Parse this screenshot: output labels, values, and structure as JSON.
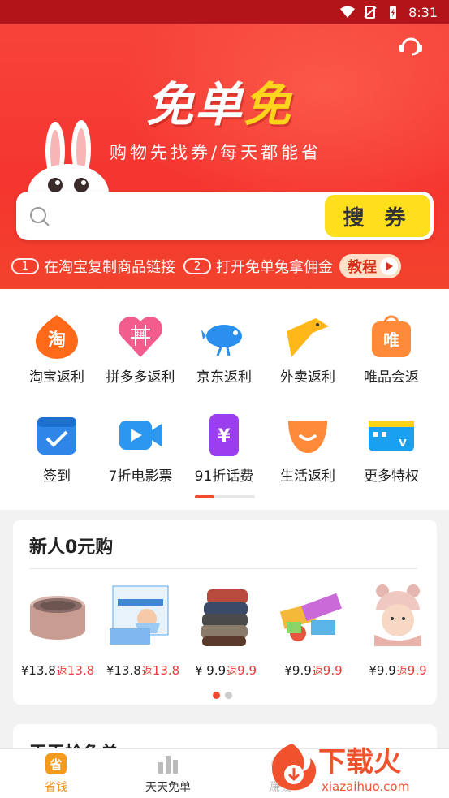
{
  "status_bar": {
    "time": "8:31"
  },
  "hero": {
    "logo_part1": "免单",
    "logo_part2": "免",
    "slogan": "购物先找券/每天都能省",
    "search": {
      "placeholder": "",
      "button_label": "搜 券"
    },
    "steps": [
      {
        "num": "1",
        "text": "在淘宝复制商品链接"
      },
      {
        "num": "2",
        "text": "打开免单兔拿佣金"
      }
    ],
    "tutorial_label": "教程"
  },
  "grid": {
    "items": [
      {
        "label": "淘宝返利",
        "icon": "taobao-icon"
      },
      {
        "label": "拼多多返利",
        "icon": "pinduoduo-icon"
      },
      {
        "label": "京东返利",
        "icon": "jd-icon"
      },
      {
        "label": "外卖返利",
        "icon": "takeout-icon"
      },
      {
        "label": "唯品会返",
        "icon": "vipshop-icon"
      },
      {
        "label": "签到",
        "icon": "checkin-icon"
      },
      {
        "label": "7折电影票",
        "icon": "movie-icon"
      },
      {
        "label": "91折话费",
        "icon": "phone-bill-icon"
      },
      {
        "label": "生活返利",
        "icon": "life-icon"
      },
      {
        "label": "更多特权",
        "icon": "vip-card-icon"
      }
    ]
  },
  "newcomer": {
    "title": "新人0元购",
    "products": [
      {
        "price": "¥13.8",
        "rebate_label": "返",
        "rebate": "13.8",
        "image": "speaker"
      },
      {
        "price": "¥13.8",
        "rebate_label": "返",
        "rebate": "13.8",
        "image": "mask"
      },
      {
        "price": "¥ 9.9",
        "rebate_label": "返",
        "rebate": "9.9",
        "image": "socks"
      },
      {
        "price": "¥9.9",
        "rebate_label": "返",
        "rebate": "9.9",
        "image": "blocks"
      },
      {
        "price": "¥9.9",
        "rebate_label": "返",
        "rebate": "9.9",
        "image": "baby-hat"
      }
    ]
  },
  "daily": {
    "title": "天天抢免单"
  },
  "tabbar": {
    "tabs": [
      {
        "label": "省钱",
        "icon": "save-money-icon",
        "active": true
      },
      {
        "label": "天天免单",
        "icon": "bar-chart-icon",
        "active": false
      },
      {
        "label": "赚钱",
        "icon": "earn-icon",
        "active": false
      }
    ]
  },
  "watermark": {
    "brand": "下载火",
    "domain": "xiazaihuo.com"
  },
  "colors": {
    "hero_red": "#f5352f",
    "accent_yellow": "#ffde1b",
    "rebate_red": "#f0393a",
    "tab_active": "#f08a1c"
  }
}
